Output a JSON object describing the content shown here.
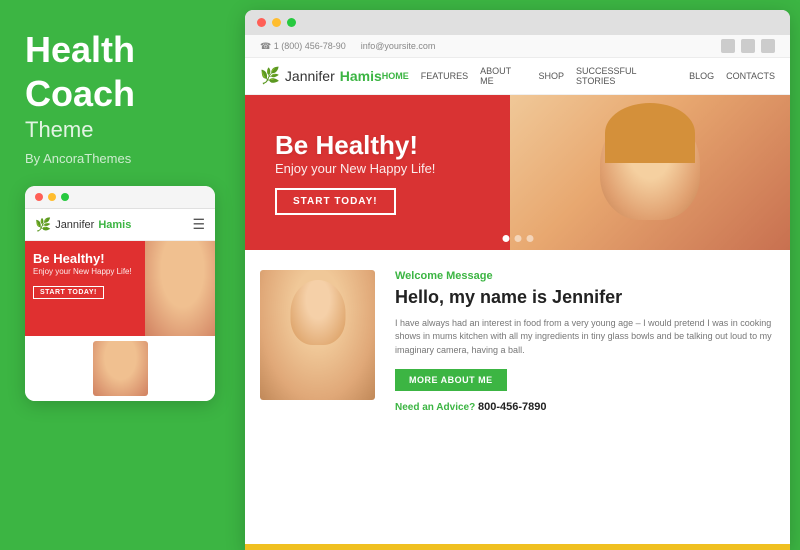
{
  "left": {
    "title_line1": "Health",
    "title_line2": "Coach",
    "subtitle": "Theme",
    "by": "By AncoraThemes",
    "mobile": {
      "dots": [
        "red",
        "yellow",
        "green"
      ],
      "logo_first": "Jannifer",
      "logo_last": "Hamis",
      "hero_heading": "Be Healthy!",
      "hero_sub": "Enjoy your New Happy Life!",
      "hero_btn": "START TODAY!"
    }
  },
  "right": {
    "browser_dots": [
      "red",
      "yellow",
      "green"
    ],
    "topbar": {
      "phone": "☎ 1 (800) 456-78-90",
      "email": "info@yoursite.com"
    },
    "nav": {
      "logo_first": "Jannifer",
      "logo_last": "Hamis",
      "links": [
        "HOME",
        "FEATURES",
        "ABOUT ME",
        "SHOP",
        "SUCCESSFUL STORIES",
        "BLOG",
        "CONTACTS"
      ]
    },
    "hero": {
      "heading": "Be Healthy!",
      "subheading": "Enjoy your New Happy Life!",
      "btn": "START TODAY!"
    },
    "content": {
      "welcome": "Welcome Message",
      "heading": "Hello, my name is Jennifer",
      "body": "I have always had an interest in food from a very young age – I would pretend I was in cooking shows in mums kitchen with all my ingredients in tiny glass bowls and be talking out loud to my imaginary camera, having a ball.",
      "more_btn": "MORE ABOUT ME",
      "advice_label": "Need an Advice?",
      "phone": "800-456-7890"
    }
  }
}
